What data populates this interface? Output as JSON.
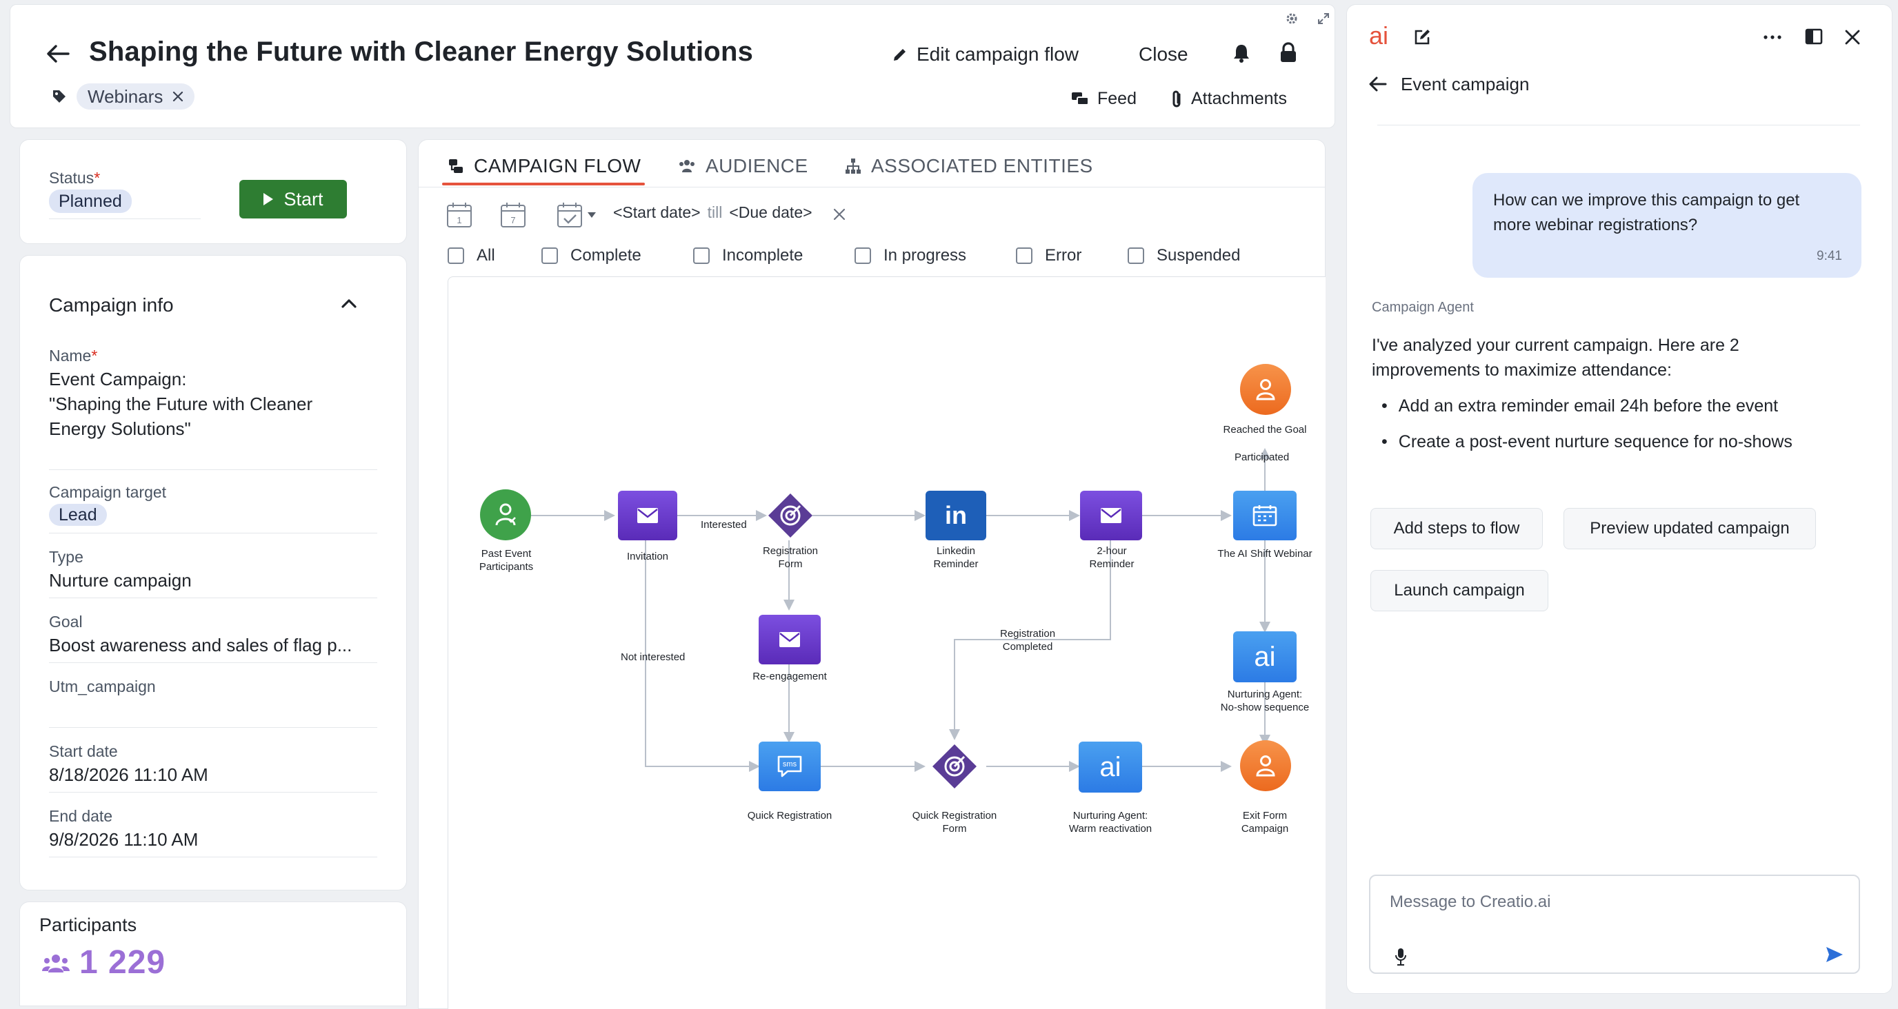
{
  "header": {
    "title": "Shaping the Future with Cleaner Energy Solutions",
    "tag": "Webinars",
    "edit_flow": "Edit campaign flow",
    "close": "Close",
    "feed": "Feed",
    "attachments": "Attachments"
  },
  "status": {
    "label": "Status",
    "value": "Planned",
    "start_button": "Start"
  },
  "campaign_info": {
    "title": "Campaign info",
    "name_label": "Name",
    "name_lines": [
      "Event Campaign:",
      "\"Shaping the Future with Cleaner",
      "Energy Solutions\""
    ],
    "target_label": "Campaign target",
    "target_value": "Lead",
    "type_label": "Type",
    "type_value": "Nurture campaign",
    "goal_label": "Goal",
    "goal_value": "Boost awareness and sales of flag p...",
    "utm_label": "Utm_campaign",
    "utm_value": "",
    "start_label": "Start date",
    "start_value": "8/18/2026 11:10 AM",
    "end_label": "End date",
    "end_value": "9/8/2026 11:10 AM"
  },
  "participants": {
    "label": "Participants",
    "count": "1 229"
  },
  "tabs": [
    "CAMPAIGN FLOW",
    "AUDIENCE",
    "ASSOCIATED ENTITIES"
  ],
  "date_filter": {
    "start": "<Start date>",
    "till": "till",
    "due": "<Due date>",
    "cal1": "1",
    "cal7": "7"
  },
  "filters": [
    "All",
    "Complete",
    "Incomplete",
    "In progress",
    "Error",
    "Suspended"
  ],
  "flow": {
    "nodes": {
      "past_event": [
        "Past Event",
        "Participants"
      ],
      "invitation": [
        "Invitation"
      ],
      "reg_form": [
        "Registration",
        "Form"
      ],
      "linkedin": [
        "Linkedin",
        "Reminder"
      ],
      "two_hour": [
        "2-hour",
        "Reminder"
      ],
      "webinar": [
        "The AI Shift Webinar"
      ],
      "reached_goal": [
        "Reached the Goal"
      ],
      "reengagement": [
        "Re-engagement"
      ],
      "quick_reg": [
        "Quick Registration"
      ],
      "quick_reg_form": [
        "Quick Registration",
        "Form"
      ],
      "nurturing_warm": [
        "Nurturing Agent:",
        "Warm reactivation"
      ],
      "nurturing_noshow": [
        "Nurturing Agent:",
        "No-show sequence"
      ],
      "exit_form": [
        "Exit Form",
        "Campaign"
      ]
    },
    "edges": {
      "interested": "Interested",
      "not_interested": "Not interested",
      "participated": "Participated",
      "reg_completed": [
        "Registration",
        "Completed"
      ]
    },
    "icon_text": {
      "sms": "sms",
      "linkedin": "in",
      "ai": "ai"
    }
  },
  "chat": {
    "logo": "ai",
    "header_title": "Event campaign",
    "user_message": [
      "How can we improve this campaign to get",
      "more webinar registrations?"
    ],
    "user_time": "9:41",
    "agent_name": "Campaign Agent",
    "agent_intro": [
      "I've analyzed your current campaign. Here are 2",
      "improvements to maximize attendance:"
    ],
    "bullets": [
      "Add an extra reminder email 24h before the event",
      "Create a post-event nurture sequence for no-shows"
    ],
    "actions": [
      "Add steps to flow",
      "Preview updated campaign",
      "Launch campaign"
    ],
    "input_placeholder": "Message to Creatio.ai"
  },
  "colors": {
    "accent_red": "#e5533d",
    "start_green": "#2e7d32",
    "purple": "#6a3fc8",
    "blue": "#2c7be5",
    "orange": "#f0782a",
    "green_node": "#3fa24a",
    "participants_purple": "#9b6fd6"
  }
}
